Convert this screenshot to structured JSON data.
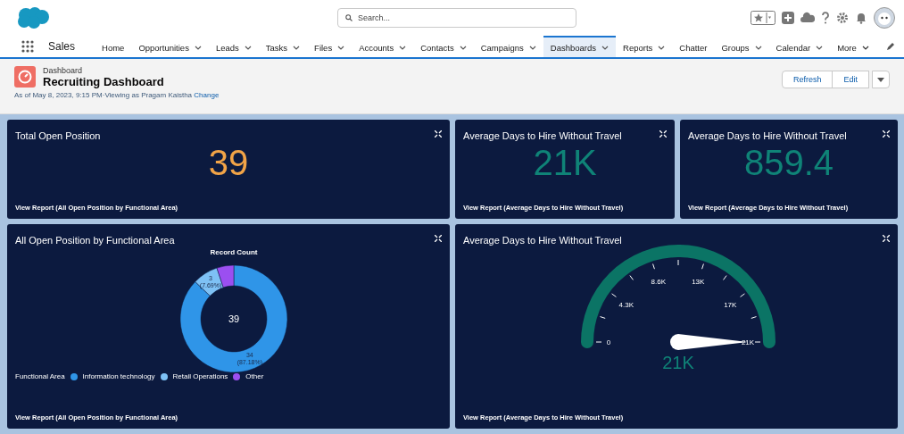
{
  "header": {
    "search": {
      "placeholder": "Search..."
    }
  },
  "nav": {
    "app_name": "Sales",
    "items": [
      {
        "label": "Home",
        "has_menu": false,
        "selected": false
      },
      {
        "label": "Opportunities",
        "has_menu": true,
        "selected": false
      },
      {
        "label": "Leads",
        "has_menu": true,
        "selected": false
      },
      {
        "label": "Tasks",
        "has_menu": true,
        "selected": false
      },
      {
        "label": "Files",
        "has_menu": true,
        "selected": false
      },
      {
        "label": "Accounts",
        "has_menu": true,
        "selected": false
      },
      {
        "label": "Contacts",
        "has_menu": true,
        "selected": false
      },
      {
        "label": "Campaigns",
        "has_menu": true,
        "selected": false
      },
      {
        "label": "Dashboards",
        "has_menu": true,
        "selected": true
      },
      {
        "label": "Reports",
        "has_menu": true,
        "selected": false
      },
      {
        "label": "Chatter",
        "has_menu": false,
        "selected": false
      },
      {
        "label": "Groups",
        "has_menu": true,
        "selected": false
      },
      {
        "label": "Calendar",
        "has_menu": true,
        "selected": false
      },
      {
        "label": "More",
        "has_menu": true,
        "selected": false
      }
    ]
  },
  "page_header": {
    "eyebrow": "Dashboard",
    "title": "Recruiting Dashboard",
    "subtitle": "As of May 8, 2023, 9:15 PM·Viewing as Pragam Kaistha",
    "subtitle_link": "Change",
    "buttons": [
      "Refresh",
      "Edit"
    ]
  },
  "widgets": [
    {
      "kind": "metric",
      "title": "Total Open Position",
      "value": "39",
      "color": "#f2a447",
      "footer": "View Report (All Open Position by Functional Area)"
    },
    {
      "kind": "metric",
      "title": "Average Days to Hire Without Travel",
      "value": "21K",
      "color": "#0f8377",
      "footer": "View Report (Average Days to Hire Without Travel)"
    },
    {
      "kind": "metric",
      "title": "Average Days to Hire Without Travel",
      "value": "859.4",
      "color": "#0f8377",
      "footer": "View Report (Average Days to Hire Without Travel)"
    },
    {
      "kind": "donut",
      "title": "All Open Position by Functional Area",
      "center_value": "39",
      "legend_title": "Functional Area",
      "footer": "View Report (All Open Position by Functional Area)",
      "chart_data": {
        "type": "donut",
        "title": "Record Count",
        "categories": [
          "Information technology",
          "Retail Operations",
          "Other"
        ],
        "series": [
          {
            "values": [
              87.18,
              7.69,
              5.13
            ]
          }
        ],
        "colors": [
          "#2f95e8",
          "#7ec1f5",
          "#9b4ff0"
        ],
        "value_labels": [
          "34",
          "3",
          null
        ],
        "annotations": [
          "(87.18%)",
          "(7.69%)",
          null
        ]
      }
    },
    {
      "kind": "gauge",
      "title": "Average Days to Hire Without Travel",
      "value": "21K",
      "ticks": [
        "0",
        "4.3K",
        "8.6K",
        "13K",
        "17K",
        "21K"
      ],
      "footer": "View Report (Average Days to Hire Without Travel)"
    }
  ]
}
